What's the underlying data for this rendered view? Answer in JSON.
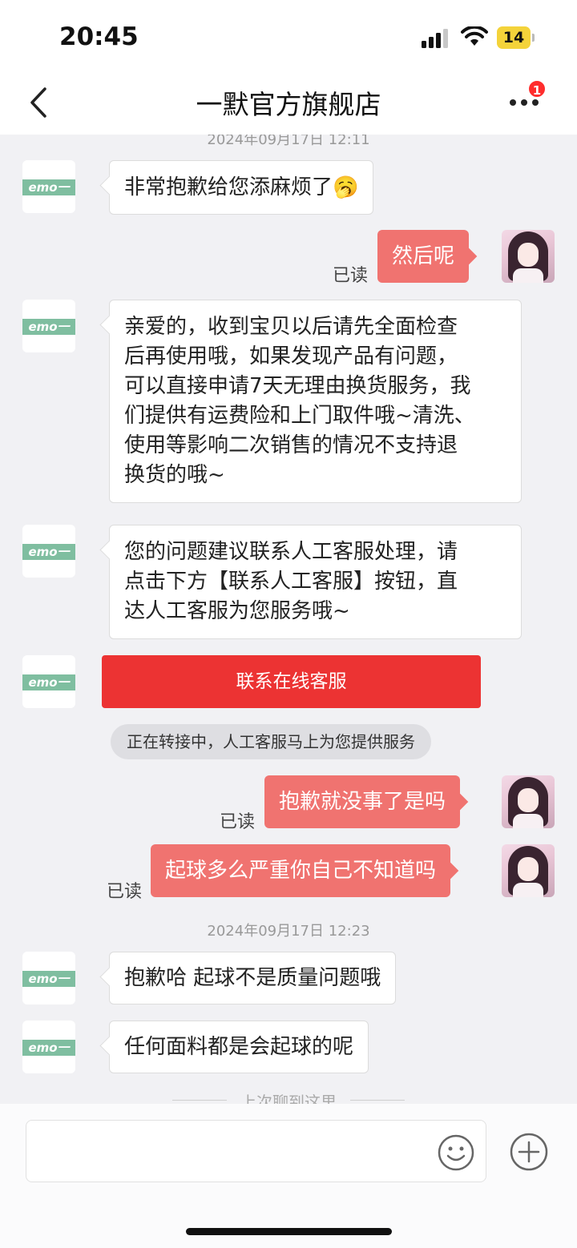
{
  "status_bar": {
    "time": "20:45",
    "battery_level": "14",
    "icons": [
      "signal-icon",
      "wifi-icon",
      "battery-icon"
    ]
  },
  "nav": {
    "title": "一默官方旗舰店",
    "badge_count": "1",
    "icons": [
      "back-icon",
      "more-icon"
    ]
  },
  "shop_avatar_text": "emo一默",
  "timestamps": {
    "top_partial": "2024年09月17日 12:11",
    "second": "2024年09月17日 12:23"
  },
  "messages": {
    "m1": "非常抱歉给您添麻烦了",
    "m1_emoji": "🥱",
    "m2": "然后呢",
    "m3": "亲爱的，收到宝贝以后请先全面检查后再使用哦，如果发现产品有问题，可以直接申请7天无理由换货服务，我们提供有运费险和上门取件哦~清洗、使用等影响二次销售的情况不支持退换货的哦~",
    "m3_lines": [
      "亲爱的，收到宝贝以后请先全面检查",
      "后再使用哦，如果发现产品有问题，",
      "可以直接申请7天无理由换货服务，我",
      "们提供有运费险和上门取件哦~清洗、",
      "使用等影响二次销售的情况不支持退",
      "换货的哦~"
    ],
    "m4_lines": [
      "您的问题建议联系人工客服处理，请",
      "点击下方【联系人工客服】按钮，直",
      "达人工客服为您服务哦~"
    ],
    "contact_button": "联系在线客服",
    "system_notice": "正在转接中，人工客服马上为您提供服务",
    "m5": "抱歉就没事了是吗",
    "m6": "起球多么严重你自己不知道吗",
    "m7": "抱歉哈 起球不是质量问题哦",
    "m8": "任何面料都是会起球的呢",
    "read_label": "已读",
    "last_chat_divider": "上次聊到这里"
  },
  "input": {
    "placeholder": "",
    "icons": [
      "emoji-icon",
      "plus-icon"
    ]
  },
  "colors": {
    "accent_red": "#ec3333",
    "own_bubble": "#f07370",
    "chat_bg": "#f1f1f4",
    "shop_logo": "#7fbea0"
  }
}
